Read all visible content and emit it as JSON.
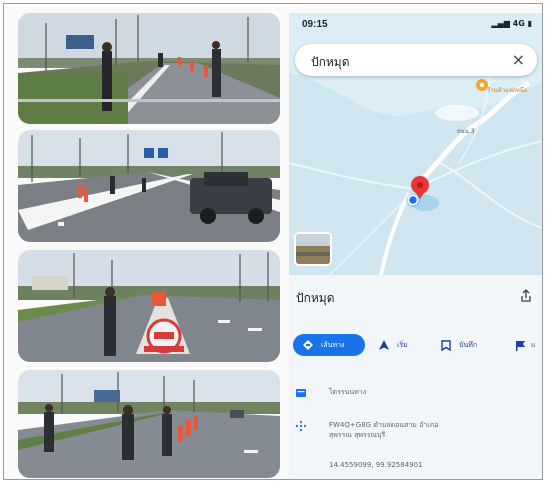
{
  "phone": {
    "status_time": "09:15",
    "signal_text": "4G",
    "search_query": "ปักหมุด",
    "map_poi_label": "ร้านค้าแห่งหนึ่ง",
    "map_road_label": "ถนน 3",
    "place_title": "ปักหมุด",
    "place_subtitle": "",
    "actions": {
      "directions_label": "เส้นทาง",
      "start_label": "เริ่ม",
      "save_label": "บันทึก",
      "more_label": "แ"
    },
    "info": {
      "line1": "ไดรรนนทาง",
      "line2a": "FW4Q+G8G ตำบลดอนสาม อำเภอ",
      "line2b": "สุพรรณ สุพรรณบุรี",
      "line3": "14.4559099, 99.92584901"
    }
  },
  "colors": {
    "accent_blue": "#1a73e8",
    "pin_red": "#e53935",
    "poi_orange": "#f4a62a",
    "map_water": "#cfe5ef"
  },
  "icons": [
    "close-icon",
    "share-icon",
    "directions-icon",
    "navigation-icon",
    "bookmark-icon",
    "flag-icon",
    "card-icon",
    "plus-code-icon",
    "location-pin-icon"
  ]
}
